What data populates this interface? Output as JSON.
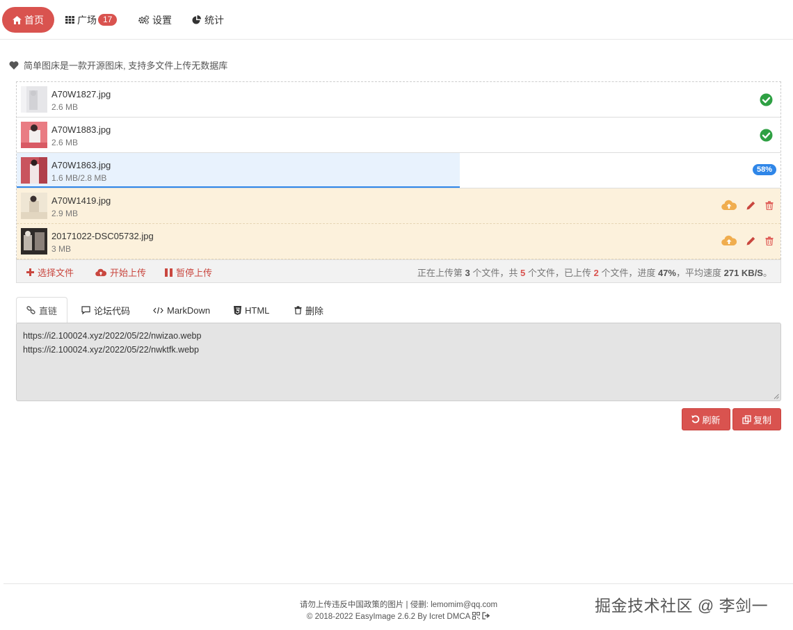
{
  "nav": {
    "items": [
      {
        "label": "首页",
        "icon": "home-icon",
        "active": true
      },
      {
        "label": "广场",
        "icon": "grid-icon",
        "badge": "17"
      },
      {
        "label": "设置",
        "icon": "gears-icon"
      },
      {
        "label": "统计",
        "icon": "pie-chart-icon"
      }
    ]
  },
  "notice": {
    "text": "简单图床是一款开源图床, 支持多文件上传无数据库",
    "icon": "heart-icon"
  },
  "files": [
    {
      "name": "A70W1827.jpg",
      "size": "2.6 MB",
      "status": "done"
    },
    {
      "name": "A70W1883.jpg",
      "size": "2.6 MB",
      "status": "done"
    },
    {
      "name": "A70W1863.jpg",
      "size": "1.6 MB/2.8 MB",
      "status": "uploading",
      "progress": 0.58,
      "progress_label": "58%"
    },
    {
      "name": "A70W1419.jpg",
      "size": "2.9 MB",
      "status": "queued"
    },
    {
      "name": "20171022-DSC05732.jpg",
      "size": "3 MB",
      "status": "queued"
    }
  ],
  "toolbar": {
    "select_label": "选择文件",
    "start_label": "开始上传",
    "pause_label": "暂停上传",
    "status": {
      "p1": "正在上传第 ",
      "current": "3",
      "p2": " 个文件，共 ",
      "total": "5",
      "p3": " 个文件，已上传 ",
      "uploaded": "2",
      "p4": " 个文件，进度 ",
      "progress": "47%",
      "p5": "，平均速度 ",
      "speed": "271 KB/S",
      "p6": "。"
    }
  },
  "tabs": [
    {
      "label": "直链",
      "icon": "link-icon",
      "active": true
    },
    {
      "label": "论坛代码",
      "icon": "comment-icon"
    },
    {
      "label": "MarkDown",
      "icon": "code-icon"
    },
    {
      "label": "HTML",
      "icon": "html5-icon"
    },
    {
      "label": "删除",
      "icon": "trash-icon"
    }
  ],
  "links": {
    "line1": "https://i2.100024.xyz/2022/05/22/nwizao.webp",
    "line2": "https://i2.100024.xyz/2022/05/22/nwktfk.webp"
  },
  "buttons": {
    "refresh_label": "刷新",
    "copy_label": "复制"
  },
  "footer": {
    "line1": "请勿上传违反中国政策的图片 | 侵删: lemomim@qq.com",
    "line2": "© 2018-2022 EasyImage 2.6.2 By Icret DMCA"
  },
  "watermark": "掘金技术社区 @ 李剑一",
  "colors": {
    "accent": "#d9534f",
    "progress": "#2f86e8",
    "success": "#2ea043",
    "warning": "#f0ad4e"
  }
}
